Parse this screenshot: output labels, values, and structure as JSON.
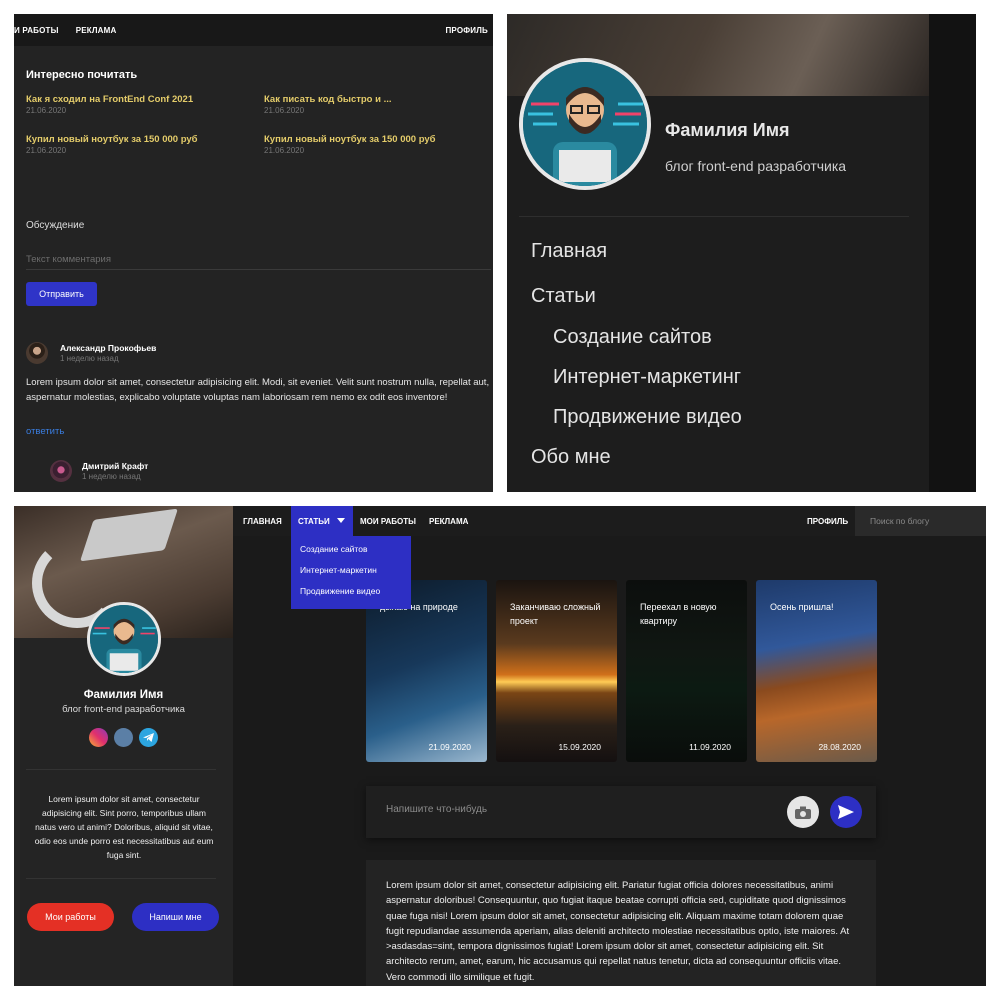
{
  "panel_a": {
    "nav": {
      "works": "И РАБОТЫ",
      "ads": "РЕКЛАМА",
      "profile": "ПРОФИЛЬ"
    },
    "section_title": "Интересно почитать",
    "articles": [
      {
        "title": "Как я сходил на FrontEnd Conf 2021",
        "date": "21.06.2020"
      },
      {
        "title": "Как писать код быстро и ...",
        "date": "21.06.2020"
      },
      {
        "title": "Купил новый ноутбук за 150 000 руб",
        "date": "21.06.2020"
      },
      {
        "title": "Купил новый ноутбук за 150 000 руб",
        "date": "21.06.2020"
      }
    ],
    "discussion_label": "Обсуждение",
    "comment_placeholder": "Текст комментария",
    "send_label": "Отправить",
    "comments": [
      {
        "author": "Александр Прокофьев",
        "time": "1 неделю назад",
        "text": "Lorem ipsum dolor sit amet, consectetur adipisicing elit. Modi, sit eveniet. Velit sunt nostrum nulla, repellat aut, aspernatur molestias, explicabo voluptate voluptas nam laboriosam rem nemo ex odit eos inventore!",
        "reply": "ответить"
      },
      {
        "author": "Дмитрий Крафт",
        "time": "1 неделю назад"
      }
    ]
  },
  "panel_b": {
    "name": "Фамилия Имя",
    "description": "блог front-end разработчика",
    "menu": [
      "Главная",
      "Статьи",
      "Создание сайтов",
      "Интернет-маркетинг",
      "Продвижение видео",
      "Обо мне"
    ]
  },
  "panel_c": {
    "sidebar": {
      "name": "Фамилия Имя",
      "description": "блог front-end разработчика",
      "social": [
        "instagram-icon",
        "vk-icon",
        "telegram-icon"
      ],
      "about": "Lorem ipsum dolor sit amet, consectetur adipisicing elit. Sint porro, temporibus ullam natus vero ut animi? Doloribus, aliquid sit vitae, odio eos unde porro est necessitatibus aut eum fuga sint.",
      "btn_works": "Мои работы",
      "btn_write": "Напиши мне"
    },
    "nav": {
      "home": "ГЛАВНАЯ",
      "articles": "СТАТЬИ",
      "works": "МОИ РАБОТЫ",
      "ads": "РЕКЛАМА",
      "profile": "ПРОФИЛЬ",
      "search_placeholder": "Поиск по блогу"
    },
    "dropdown": [
      "Создание сайтов",
      "Интернет-маркетин",
      "Продвижение видео"
    ],
    "stories": [
      {
        "title": "дыхаю на природе",
        "date": "21.09.2020"
      },
      {
        "title": "Заканчиваю сложный проект",
        "date": "15.09.2020"
      },
      {
        "title": "Переехал в новую квартиру",
        "date": "11.09.2020"
      },
      {
        "title": "Осень пришла!",
        "date": "28.08.2020"
      }
    ],
    "post_placeholder": "Напишите что-нибудь",
    "post_text": "Lorem ipsum dolor sit amet, consectetur adipisicing elit. Pariatur fugiat officia dolores necessitatibus, animi aspernatur doloribus! Consequuntur, quo fugiat itaque beatae corrupti officia sed, cupiditate quod dignissimos quae fuga nisi! Lorem ipsum dolor sit amet, consectetur adipisicing elit. Aliquam maxime totam dolorem quae fugit repudiandae assumenda aperiam, alias deleniti architecto molestiae necessitatibus optio, iste maiores. At >asdasdas=sint, tempora dignissimos fugiat! Lorem ipsum dolor sit amet, consectetur adipisicing elit. Sit architecto rerum, amet, earum, hic accusamus qui repellat natus tenetur, dicta ad consequuntur officiis vitae. Vero commodi illo similique et fugit."
  },
  "colors": {
    "accent_blue": "#2d2fc4",
    "accent_red": "#e43025",
    "article_gold": "#e4cc6a",
    "link_blue": "#3a7de0"
  }
}
